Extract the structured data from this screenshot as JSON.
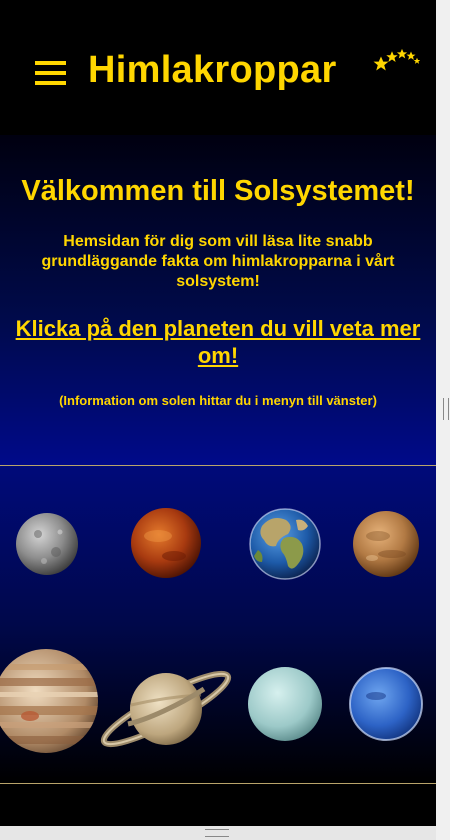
{
  "header": {
    "title": "Himlakroppar",
    "menu_icon": "hamburger-menu-icon",
    "logo_icon": "stars-logo-icon"
  },
  "hero": {
    "heading": "Välkommen till Solsystemet!",
    "intro": "Hemsidan för dig som vill läsa lite snabb grundläggande fakta om himlakropparna i vårt solsystem!",
    "cta": "Klicka på den planeten du vill veta mer om!",
    "note": "(Information om solen hittar du i menyn till vänster)"
  },
  "planets": [
    {
      "id": "mercury",
      "icon": "mercury-planet-icon"
    },
    {
      "id": "venus",
      "icon": "venus-planet-icon"
    },
    {
      "id": "earth",
      "icon": "earth-planet-icon"
    },
    {
      "id": "mars",
      "icon": "mars-planet-icon"
    },
    {
      "id": "jupiter",
      "icon": "jupiter-planet-icon"
    },
    {
      "id": "saturn",
      "icon": "saturn-planet-icon"
    },
    {
      "id": "uranus",
      "icon": "uranus-planet-icon"
    },
    {
      "id": "neptune",
      "icon": "neptune-planet-icon"
    }
  ],
  "colors": {
    "accent": "#ffd600",
    "background": "#000000",
    "hero_gradient_end": "#000a8a"
  }
}
